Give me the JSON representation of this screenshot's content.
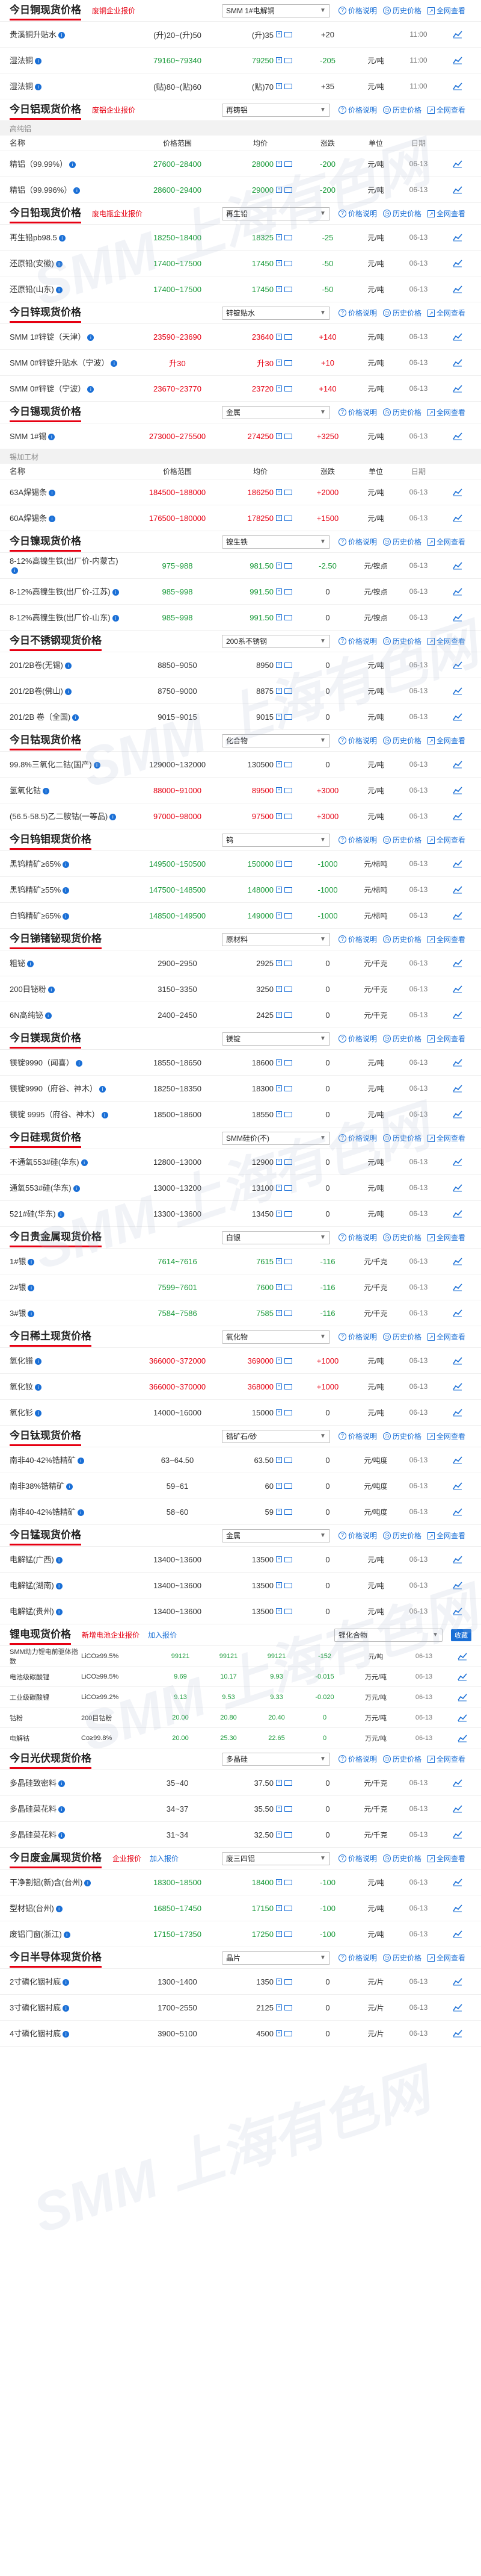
{
  "common": {
    "corp_price": "废铜企业报价",
    "price_desc": "价格说明",
    "history": "历史价格",
    "full_view": "全网查看",
    "info_glyph": "i",
    "chev": "▼",
    "cols": {
      "name": "名称",
      "range": "价格范围",
      "avg": "均价",
      "chg": "涨跌",
      "unit": "单位",
      "date": "日期"
    }
  },
  "watermark": "SMM 上海有色网",
  "sections": [
    {
      "id": "copper",
      "title": "今日铜现货价格",
      "corp": "废铜企业报价",
      "select": "SMM 1#电解铜",
      "header_cols": false,
      "rows": [
        {
          "name": "贵溪铜升贴水",
          "range": "(升)20~(升)50",
          "avg": "(升)35",
          "chg": "+20",
          "unit": "",
          "date": "11:00",
          "tone": "black",
          "chg_tone": "black"
        },
        {
          "name": "湿法铜",
          "range": "79160~79340",
          "avg": "79250",
          "chg": "-205",
          "unit": "元/吨",
          "date": "11:00",
          "tone": "green",
          "chg_tone": "green"
        },
        {
          "name": "湿法铜",
          "range": "(贴)80~(贴)60",
          "avg": "(贴)70",
          "chg": "+35",
          "unit": "元/吨",
          "date": "11:00",
          "tone": "black",
          "chg_tone": "black"
        }
      ]
    },
    {
      "id": "aluminum",
      "title": "今日铝现货价格",
      "corp": "废铝企业报价",
      "select": "再铸铝",
      "subhead": "高纯铝",
      "header_cols": true,
      "rows": [
        {
          "name": "精铝（99.99%）",
          "range": "27600~28400",
          "avg": "28000",
          "chg": "-200",
          "unit": "元/吨",
          "date": "06-13",
          "tone": "green",
          "chg_tone": "green"
        },
        {
          "name": "精铝（99.996%）",
          "range": "28600~29400",
          "avg": "29000",
          "chg": "-200",
          "unit": "元/吨",
          "date": "06-13",
          "tone": "green",
          "chg_tone": "green"
        }
      ]
    },
    {
      "id": "lead",
      "title": "今日铅现货价格",
      "corp": "废电瓶企业报价",
      "select": "再生铅",
      "header_cols": false,
      "rows": [
        {
          "name": "再生铅pb98.5",
          "range": "18250~18400",
          "avg": "18325",
          "chg": "-25",
          "unit": "元/吨",
          "date": "06-13",
          "tone": "green",
          "chg_tone": "green"
        },
        {
          "name": "还原铅(安徽)",
          "range": "17400~17500",
          "avg": "17450",
          "chg": "-50",
          "unit": "元/吨",
          "date": "06-13",
          "tone": "green",
          "chg_tone": "green"
        },
        {
          "name": "还原铅(山东)",
          "range": "17400~17500",
          "avg": "17450",
          "chg": "-50",
          "unit": "元/吨",
          "date": "06-13",
          "tone": "green",
          "chg_tone": "green"
        }
      ]
    },
    {
      "id": "zinc",
      "title": "今日锌现货价格",
      "select": "锌锭贴水",
      "header_cols": false,
      "rows": [
        {
          "name": "SMM 1#锌锭（天津）",
          "range": "23590~23690",
          "avg": "23640",
          "chg": "+140",
          "unit": "元/吨",
          "date": "06-13",
          "tone": "red",
          "chg_tone": "red"
        },
        {
          "name": "SMM 0#锌锭升贴水（宁波）",
          "range": "升30",
          "avg": "升30",
          "chg": "+10",
          "unit": "元/吨",
          "date": "06-13",
          "tone": "red",
          "chg_tone": "red"
        },
        {
          "name": "SMM 0#锌锭（宁波）",
          "range": "23670~23770",
          "avg": "23720",
          "chg": "+140",
          "unit": "元/吨",
          "date": "06-13",
          "tone": "red",
          "chg_tone": "red"
        }
      ]
    },
    {
      "id": "tin",
      "title": "今日锡现货价格",
      "select": "金属",
      "header_cols": false,
      "rows": [
        {
          "name": "SMM 1#锡",
          "range": "273000~275500",
          "avg": "274250",
          "chg": "+3250",
          "unit": "元/吨",
          "date": "06-13",
          "tone": "red",
          "chg_tone": "red"
        }
      ],
      "subhead2": "锡加工材",
      "header_cols2": true,
      "rows2": [
        {
          "name": "63A焊锡条",
          "range": "184500~188000",
          "avg": "186250",
          "chg": "+2000",
          "unit": "元/吨",
          "date": "06-13",
          "tone": "red",
          "chg_tone": "red"
        },
        {
          "name": "60A焊锡条",
          "range": "176500~180000",
          "avg": "178250",
          "chg": "+1500",
          "unit": "元/吨",
          "date": "06-13",
          "tone": "red",
          "chg_tone": "red"
        }
      ]
    },
    {
      "id": "nickel",
      "title": "今日镍现货价格",
      "select": "镍生铁",
      "header_cols": false,
      "rows": [
        {
          "name": "8-12%高镍生铁(出厂价-内蒙古)",
          "range": "975~988",
          "avg": "981.50",
          "chg": "-2.50",
          "unit": "元/镍点",
          "date": "06-13",
          "tone": "green",
          "chg_tone": "green"
        },
        {
          "name": "8-12%高镍生铁(出厂价-江苏)",
          "range": "985~998",
          "avg": "991.50",
          "chg": "0",
          "unit": "元/镍点",
          "date": "06-13",
          "tone": "green",
          "chg_tone": "black"
        },
        {
          "name": "8-12%高镍生铁(出厂价-山东)",
          "range": "985~998",
          "avg": "991.50",
          "chg": "0",
          "unit": "元/镍点",
          "date": "06-13",
          "tone": "green",
          "chg_tone": "black"
        }
      ]
    },
    {
      "id": "stainless",
      "title": "今日不锈钢现货价格",
      "select": "200系不锈钢",
      "header_cols": false,
      "rows": [
        {
          "name": "201/2B卷(无锡)",
          "range": "8850~9050",
          "avg": "8950",
          "chg": "0",
          "unit": "元/吨",
          "date": "06-13",
          "tone": "black",
          "chg_tone": "black"
        },
        {
          "name": "201/2B卷(佛山)",
          "range": "8750~9000",
          "avg": "8875",
          "chg": "0",
          "unit": "元/吨",
          "date": "06-13",
          "tone": "black",
          "chg_tone": "black"
        },
        {
          "name": "201/2B 卷（全国)",
          "range": "9015~9015",
          "avg": "9015",
          "chg": "0",
          "unit": "元/吨",
          "date": "06-13",
          "tone": "black",
          "chg_tone": "black"
        }
      ]
    },
    {
      "id": "cobalt",
      "title": "今日钴现货价格",
      "select": "化合物",
      "header_cols": false,
      "rows": [
        {
          "name": "99.8%三氧化二钴(国产)",
          "range": "129000~132000",
          "avg": "130500",
          "chg": "0",
          "unit": "元/吨",
          "date": "06-13",
          "tone": "black",
          "chg_tone": "black"
        },
        {
          "name": "氢氧化钴",
          "range": "88000~91000",
          "avg": "89500",
          "chg": "+3000",
          "unit": "元/吨",
          "date": "06-13",
          "tone": "red",
          "chg_tone": "red"
        },
        {
          "name": "(56.5-58.5)乙二胺钴(一等品)",
          "range": "97000~98000",
          "avg": "97500",
          "chg": "+3000",
          "unit": "元/吨",
          "date": "06-13",
          "tone": "red",
          "chg_tone": "red"
        }
      ]
    },
    {
      "id": "tungsten",
      "title": "今日钨钼现货价格",
      "select": "钨",
      "header_cols": false,
      "rows": [
        {
          "name": "黑钨精矿≥65%",
          "range": "149500~150500",
          "avg": "150000",
          "chg": "-1000",
          "unit": "元/标吨",
          "date": "06-13",
          "tone": "green",
          "chg_tone": "green"
        },
        {
          "name": "黑钨精矿≥55%",
          "range": "147500~148500",
          "avg": "148000",
          "chg": "-1000",
          "unit": "元/标吨",
          "date": "06-13",
          "tone": "green",
          "chg_tone": "green"
        },
        {
          "name": "白钨精矿≥65%",
          "range": "148500~149500",
          "avg": "149000",
          "chg": "-1000",
          "unit": "元/标吨",
          "date": "06-13",
          "tone": "green",
          "chg_tone": "green"
        }
      ]
    },
    {
      "id": "antimony",
      "title": "今日锑锗铋现货价格",
      "select": "原材料",
      "header_cols": false,
      "rows": [
        {
          "name": "粗铋",
          "range": "2900~2950",
          "avg": "2925",
          "chg": "0",
          "unit": "元/千克",
          "date": "06-13",
          "tone": "black",
          "chg_tone": "black"
        },
        {
          "name": "200目铋粉",
          "range": "3150~3350",
          "avg": "3250",
          "chg": "0",
          "unit": "元/千克",
          "date": "06-13",
          "tone": "black",
          "chg_tone": "black"
        },
        {
          "name": "6N高纯铋",
          "range": "2400~2450",
          "avg": "2425",
          "chg": "0",
          "unit": "元/千克",
          "date": "06-13",
          "tone": "black",
          "chg_tone": "black"
        }
      ]
    },
    {
      "id": "magnesium",
      "title": "今日镁现货价格",
      "select": "镁锭",
      "header_cols": false,
      "rows": [
        {
          "name": "镁锭9990（闻喜）",
          "range": "18550~18650",
          "avg": "18600",
          "chg": "0",
          "unit": "元/吨",
          "date": "06-13",
          "tone": "black",
          "chg_tone": "black"
        },
        {
          "name": "镁锭9990（府谷、神木）",
          "range": "18250~18350",
          "avg": "18300",
          "chg": "0",
          "unit": "元/吨",
          "date": "06-13",
          "tone": "black",
          "chg_tone": "black"
        },
        {
          "name": "镁锭 9995（府谷、神木）",
          "range": "18500~18600",
          "avg": "18550",
          "chg": "0",
          "unit": "元/吨",
          "date": "06-13",
          "tone": "black",
          "chg_tone": "black"
        }
      ]
    },
    {
      "id": "silicon",
      "title": "今日硅现货价格",
      "select": "SMM硅价(不)",
      "header_cols": false,
      "rows": [
        {
          "name": "不通氧553#硅(华东)",
          "range": "12800~13000",
          "avg": "12900",
          "chg": "0",
          "unit": "元/吨",
          "date": "06-13",
          "tone": "black",
          "chg_tone": "black"
        },
        {
          "name": "通氧553#硅(华东)",
          "range": "13000~13200",
          "avg": "13100",
          "chg": "0",
          "unit": "元/吨",
          "date": "06-13",
          "tone": "black",
          "chg_tone": "black"
        },
        {
          "name": "521#硅(华东)",
          "range": "13300~13600",
          "avg": "13450",
          "chg": "0",
          "unit": "元/吨",
          "date": "06-13",
          "tone": "black",
          "chg_tone": "black"
        }
      ]
    },
    {
      "id": "precious",
      "title": "今日贵金属现货价格",
      "select": "白银",
      "header_cols": false,
      "rows": [
        {
          "name": "1#银",
          "range": "7614~7616",
          "avg": "7615",
          "chg": "-116",
          "unit": "元/千克",
          "date": "06-13",
          "tone": "green",
          "chg_tone": "green"
        },
        {
          "name": "2#银",
          "range": "7599~7601",
          "avg": "7600",
          "chg": "-116",
          "unit": "元/千克",
          "date": "06-13",
          "tone": "green",
          "chg_tone": "green"
        },
        {
          "name": "3#银",
          "range": "7584~7586",
          "avg": "7585",
          "chg": "-116",
          "unit": "元/千克",
          "date": "06-13",
          "tone": "green",
          "chg_tone": "green"
        }
      ]
    },
    {
      "id": "rareearth",
      "title": "今日稀土现货价格",
      "select": "氧化物",
      "header_cols": false,
      "rows": [
        {
          "name": "氧化镨",
          "range": "366000~372000",
          "avg": "369000",
          "chg": "+1000",
          "unit": "元/吨",
          "date": "06-13",
          "tone": "red",
          "chg_tone": "red"
        },
        {
          "name": "氧化钕",
          "range": "366000~370000",
          "avg": "368000",
          "chg": "+1000",
          "unit": "元/吨",
          "date": "06-13",
          "tone": "red",
          "chg_tone": "red"
        },
        {
          "name": "氧化钐",
          "range": "14000~16000",
          "avg": "15000",
          "chg": "0",
          "unit": "元/吨",
          "date": "06-13",
          "tone": "black",
          "chg_tone": "black"
        }
      ]
    },
    {
      "id": "titanium",
      "title": "今日钛现货价格",
      "select": "锆矿石/砂",
      "header_cols": false,
      "rows": [
        {
          "name": "南非40-42%锆精矿",
          "range": "63~64.50",
          "avg": "63.50",
          "chg": "0",
          "unit": "元/吨度",
          "date": "06-13",
          "tone": "black",
          "chg_tone": "black"
        },
        {
          "name": "南非38%锆精矿",
          "range": "59~61",
          "avg": "60",
          "chg": "0",
          "unit": "元/吨度",
          "date": "06-13",
          "tone": "black",
          "chg_tone": "black"
        },
        {
          "name": "南非40-42%锆精矿",
          "range": "58~60",
          "avg": "59",
          "chg": "0",
          "unit": "元/吨度",
          "date": "06-13",
          "tone": "black",
          "chg_tone": "black"
        }
      ]
    },
    {
      "id": "manganese",
      "title": "今日锰现货价格",
      "select": "金属",
      "header_cols": false,
      "rows": [
        {
          "name": "电解锰(广西)",
          "range": "13400~13600",
          "avg": "13500",
          "chg": "0",
          "unit": "元/吨",
          "date": "06-13",
          "tone": "black",
          "chg_tone": "black"
        },
        {
          "name": "电解锰(湖南)",
          "range": "13400~13600",
          "avg": "13500",
          "chg": "0",
          "unit": "元/吨",
          "date": "06-13",
          "tone": "black",
          "chg_tone": "black"
        },
        {
          "name": "电解锰(贵州)",
          "range": "13400~13600",
          "avg": "13500",
          "chg": "0",
          "unit": "元/吨",
          "date": "06-13",
          "tone": "black",
          "chg_tone": "black"
        }
      ]
    }
  ],
  "lithium": {
    "title": "锂电现货价格",
    "corp": "新增电池企业报价",
    "addq": "加入报价",
    "select": "锂化合物",
    "fav": "收藏",
    "rows": [
      {
        "name": "SMM动力锂电前驱体指数",
        "spec": "LiCO≥99.5%",
        "v1": "99121",
        "v2": "99121",
        "v3": "99121",
        "chg": "-152",
        "unit": "元/吨",
        "date": "06-13",
        "tone": "green"
      },
      {
        "name": "电池级碳酸锂",
        "spec": "LiCO≥99.5%",
        "v1": "9.69",
        "v2": "10.17",
        "v3": "9.93",
        "chg": "-0.015",
        "unit": "万元/吨",
        "date": "06-13",
        "tone": "green"
      },
      {
        "name": "工业级碳酸锂",
        "spec": "LiCO≥99.2%",
        "v1": "9.13",
        "v2": "9.53",
        "v3": "9.33",
        "chg": "-0.020",
        "unit": "万元/吨",
        "date": "06-13",
        "tone": "green"
      },
      {
        "name": "钴粉",
        "spec": "200目钴粉",
        "v1": "20.00",
        "v2": "20.80",
        "v3": "20.40",
        "chg": "0",
        "unit": "万元/吨",
        "date": "06-13",
        "tone": "green"
      },
      {
        "name": "电解钴",
        "spec": "Co≥99.8%",
        "v1": "20.00",
        "v2": "25.30",
        "v3": "22.65",
        "chg": "0",
        "unit": "万元/吨",
        "date": "06-13",
        "tone": "green"
      }
    ]
  },
  "sections_tail": [
    {
      "id": "solar",
      "title": "今日光伏现货价格",
      "select": "多晶硅",
      "header_cols": false,
      "rows": [
        {
          "name": "多晶硅致密料",
          "range": "35~40",
          "avg": "37.50",
          "chg": "0",
          "unit": "元/千克",
          "date": "06-13",
          "tone": "black",
          "chg_tone": "black"
        },
        {
          "name": "多晶硅菜花料",
          "range": "34~37",
          "avg": "35.50",
          "chg": "0",
          "unit": "元/千克",
          "date": "06-13",
          "tone": "black",
          "chg_tone": "black"
        },
        {
          "name": "多晶硅菜花料",
          "range": "31~34",
          "avg": "32.50",
          "chg": "0",
          "unit": "元/千克",
          "date": "06-13",
          "tone": "black",
          "chg_tone": "black"
        }
      ]
    },
    {
      "id": "scrap",
      "title": "今日废金属现货价格",
      "corp": "企业报价",
      "addq": "加入报价",
      "select": "废三四铝",
      "header_cols": false,
      "rows": [
        {
          "name": "干净割铝(新)含(台州)",
          "range": "18300~18500",
          "avg": "18400",
          "chg": "-100",
          "unit": "元/吨",
          "date": "06-13",
          "tone": "green",
          "chg_tone": "green"
        },
        {
          "name": "型材铝(台州)",
          "range": "16850~17450",
          "avg": "17150",
          "chg": "-100",
          "unit": "元/吨",
          "date": "06-13",
          "tone": "green",
          "chg_tone": "green"
        },
        {
          "name": "废铝门窗(浙江)",
          "range": "17150~17350",
          "avg": "17250",
          "chg": "-100",
          "unit": "元/吨",
          "date": "06-13",
          "tone": "green",
          "chg_tone": "green"
        }
      ]
    },
    {
      "id": "semi",
      "title": "今日半导体现货价格",
      "select": "晶片",
      "header_cols": false,
      "rows": [
        {
          "name": "2寸磷化铟衬底",
          "range": "1300~1400",
          "avg": "1350",
          "chg": "0",
          "unit": "元/片",
          "date": "06-13",
          "tone": "black",
          "chg_tone": "black"
        },
        {
          "name": "3寸磷化铟衬底",
          "range": "1700~2550",
          "avg": "2125",
          "chg": "0",
          "unit": "元/片",
          "date": "06-13",
          "tone": "black",
          "chg_tone": "black"
        },
        {
          "name": "4寸磷化铟衬底",
          "range": "3900~5100",
          "avg": "4500",
          "chg": "0",
          "unit": "元/片",
          "date": "06-13",
          "tone": "black",
          "chg_tone": "black"
        }
      ]
    }
  ]
}
